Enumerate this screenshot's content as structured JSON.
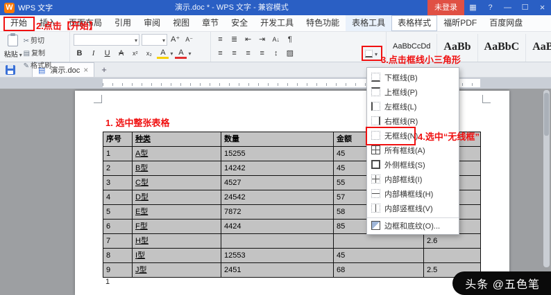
{
  "colors": {
    "titlebar_bg": "#2a5fc4",
    "login_red": "#e05044",
    "annotation_red": "#f01010",
    "selection_gray": "#c3c3c3"
  },
  "titlebar": {
    "logo_letter": "W",
    "app_name": "WPS 文字",
    "document_title": "演示.doc * - WPS 文字 - 兼容模式",
    "login_label": "未登录",
    "window_icons": [
      "apps-grid-icon",
      "help-icon",
      "minimize-icon",
      "maximize-icon",
      "close-icon"
    ]
  },
  "menubar": {
    "tabs": [
      {
        "label": "开始",
        "state": "start"
      },
      {
        "label": "插入",
        "state": ""
      },
      {
        "label": "页面布局",
        "state": ""
      },
      {
        "label": "引用",
        "state": ""
      },
      {
        "label": "审阅",
        "state": ""
      },
      {
        "label": "视图",
        "state": ""
      },
      {
        "label": "章节",
        "state": ""
      },
      {
        "label": "安全",
        "state": ""
      },
      {
        "label": "开发工具",
        "state": ""
      },
      {
        "label": "特色功能",
        "state": ""
      },
      {
        "label": "表格工具",
        "state": "ctx"
      },
      {
        "label": "表格样式",
        "state": "active"
      },
      {
        "label": "福昕PDF",
        "state": ""
      },
      {
        "label": "百度网盘",
        "state": ""
      }
    ]
  },
  "ribbon": {
    "paste_label": "粘贴",
    "cut_label": "剪切",
    "copy_label": "复制",
    "format_painter_label": "格式刷",
    "font_name_value": "",
    "font_size_value": "",
    "style_gallery": [
      {
        "preview": "AaBbCcDd"
      },
      {
        "preview": "AaBb"
      },
      {
        "preview": "AaBbC"
      },
      {
        "preview": "AaBbCc"
      }
    ]
  },
  "tabbar": {
    "document_tab": "演示.doc"
  },
  "border_menu": {
    "items": [
      {
        "label": "下框线(B)",
        "icon": "border-bottom-icon",
        "icon_class": "b-bottom",
        "state": ""
      },
      {
        "label": "上框线(P)",
        "icon": "border-top-icon",
        "icon_class": "b-top",
        "state": ""
      },
      {
        "label": "左框线(L)",
        "icon": "border-left-icon",
        "icon_class": "b-left",
        "state": ""
      },
      {
        "label": "右框线(R)",
        "icon": "border-right-icon",
        "icon_class": "b-right",
        "state": ""
      },
      {
        "label": "无框线(N)",
        "icon": "border-none-icon",
        "icon_class": "b-none",
        "state": "picked"
      },
      {
        "label": "所有框线(A)",
        "icon": "border-all-icon",
        "icon_class": "b-all",
        "state": ""
      },
      {
        "label": "外侧框线(S)",
        "icon": "border-outside-icon",
        "icon_class": "b-outside",
        "state": ""
      },
      {
        "label": "内部框线(I)",
        "icon": "border-inside-icon",
        "icon_class": "b-inside",
        "state": ""
      },
      {
        "label": "内部横框线(H)",
        "icon": "border-inside-horizontal-icon",
        "icon_class": "b-ih",
        "state": ""
      },
      {
        "label": "内部竖框线(V)",
        "icon": "border-inside-vertical-icon",
        "icon_class": "b-iv",
        "state": ""
      },
      {
        "label": "边框和底纹(O)...",
        "icon": "borders-shading-icon",
        "icon_class": "b-shade",
        "state": "septop"
      }
    ]
  },
  "document": {
    "table": {
      "headers": [
        "序号",
        "种类",
        "数量",
        "金额",
        ""
      ],
      "rows": [
        {
          "cells": [
            "1",
            "A型",
            "15255",
            "45",
            ""
          ]
        },
        {
          "cells": [
            "2",
            "B型",
            "14242",
            "45",
            ""
          ]
        },
        {
          "cells": [
            "3",
            "C型",
            "4527",
            "55",
            ""
          ]
        },
        {
          "cells": [
            "4",
            "D型",
            "24542",
            "57",
            ""
          ]
        },
        {
          "cells": [
            "5",
            "E型",
            "7872",
            "58",
            ""
          ]
        },
        {
          "cells": [
            "6",
            "F型",
            "4424",
            "85",
            ""
          ]
        },
        {
          "cells": [
            "7",
            "H型",
            "",
            "",
            "2.6"
          ]
        },
        {
          "cells": [
            "8",
            "I型",
            "12553",
            "45",
            ""
          ]
        },
        {
          "cells": [
            "9",
            "J型",
            "2451",
            "68",
            "2.5"
          ]
        }
      ]
    },
    "page_number": "1"
  },
  "annotations": {
    "step1": "1. 选中整张表格",
    "step2": "2.点击【开始】",
    "step3": "3.点击框线小三角形",
    "step4": "4.选中“无线框”"
  },
  "watermark": "头条 @五色笔"
}
